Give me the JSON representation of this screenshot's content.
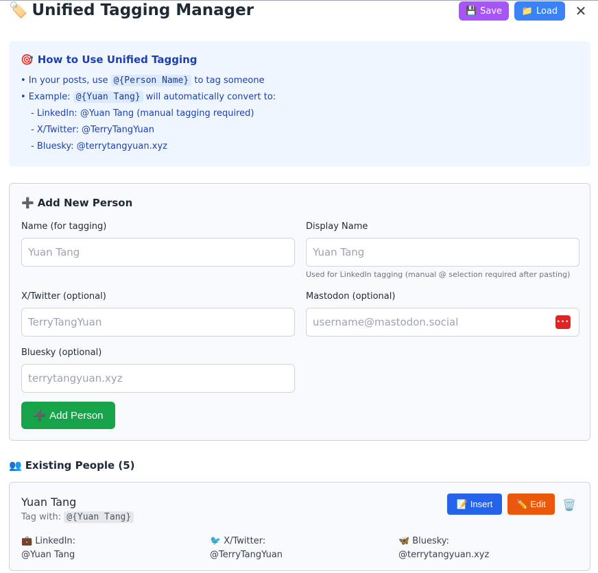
{
  "header": {
    "title_icon": "🏷️",
    "title": "Unified Tagging Manager",
    "save_icon": "💾",
    "save_label": "Save",
    "load_icon": "📁",
    "load_label": "Load",
    "close_glyph": "✕"
  },
  "howto": {
    "icon": "🎯",
    "title": "How to Use Unified Tagging",
    "line1_pre": "• In your posts, use",
    "line1_code": "@{Person Name}",
    "line1_post": "to tag someone",
    "line2_pre": "• Example:",
    "line2_code": "@{Yuan Tang}",
    "line2_post": "will automatically convert to:",
    "sub": [
      "- LinkedIn: @Yuan Tang (manual tagging required)",
      "- X/Twitter: @TerryTangYuan",
      "- Bluesky: @terrytangyuan.xyz"
    ]
  },
  "add_person": {
    "icon": "➕",
    "title": "Add New Person",
    "name_label": "Name (for tagging)",
    "name_placeholder": "Yuan Tang",
    "display_label": "Display Name",
    "display_placeholder": "Yuan Tang",
    "display_hint": "Used for LinkedIn tagging (manual @ selection required after pasting)",
    "twitter_label": "X/Twitter (optional)",
    "twitter_placeholder": "TerryTangYuan",
    "mastodon_label": "Mastodon (optional)",
    "mastodon_placeholder": "username@mastodon.social",
    "bluesky_label": "Bluesky (optional)",
    "bluesky_placeholder": "terrytangyuan.xyz",
    "add_icon": "➕",
    "add_label": "Add Person"
  },
  "existing": {
    "icon": "👥",
    "title": "Existing People (5)",
    "people": [
      {
        "name": "Yuan Tang",
        "tag_prefix": "Tag with:",
        "tag": "@{Yuan Tang}",
        "insert_icon": "📝",
        "insert_label": "Insert",
        "edit_icon": "✏️",
        "edit_label": "Edit",
        "delete_icon": "🗑️",
        "linkedin_icon": "💼",
        "linkedin_label": "LinkedIn:",
        "linkedin_value": "@Yuan Tang",
        "twitter_icon": "🐦",
        "twitter_label": "X/Twitter:",
        "twitter_value": "@TerryTangYuan",
        "bluesky_icon": "🦋",
        "bluesky_label": "Bluesky:",
        "bluesky_value": "@terrytangyuan.xyz"
      }
    ]
  }
}
